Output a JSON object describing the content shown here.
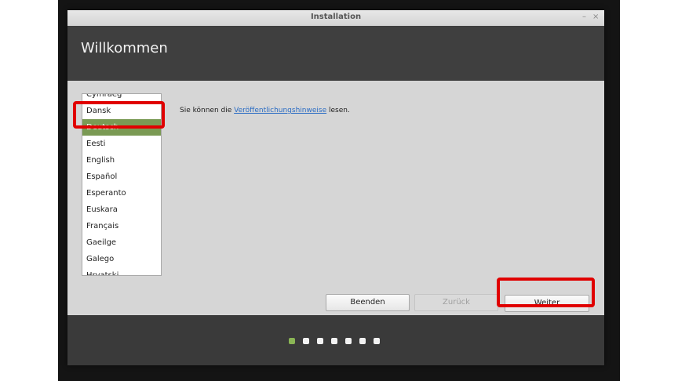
{
  "window": {
    "title": "Installation",
    "minimize_glyph": "–",
    "close_glyph": "×"
  },
  "header": {
    "title": "Willkommen"
  },
  "languages": {
    "items": [
      "Cymraeg",
      "Dansk",
      "Deutsch",
      "Eesti",
      "English",
      "Español",
      "Esperanto",
      "Euskara",
      "Français",
      "Gaeilge",
      "Galego",
      "Hrvatski"
    ],
    "selected": "Deutsch"
  },
  "release_notes": {
    "prefix": "Sie können die ",
    "link": "Veröffentlichungshinweise",
    "suffix": " lesen."
  },
  "buttons": {
    "quit": "Beenden",
    "back": "Zurück",
    "next": "Weiter"
  },
  "progress": {
    "total_steps": 7,
    "current_step": 1
  },
  "colors": {
    "selection": "#7a9a54",
    "highlight": "#e00000",
    "link": "#2a6cc4",
    "active_dot": "#8ab555"
  }
}
